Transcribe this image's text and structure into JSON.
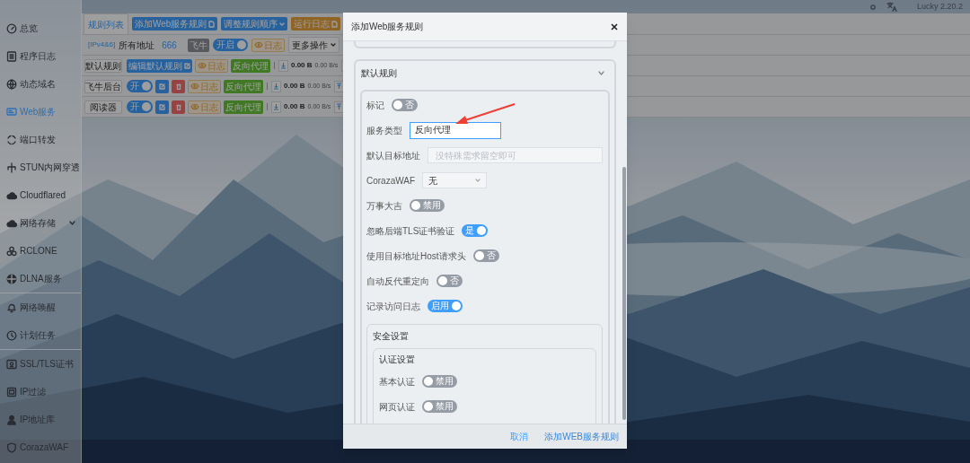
{
  "top_bar": {
    "version": "Lucky 2.20.2"
  },
  "sidebar": {
    "groups": [
      {
        "items": [
          {
            "label": "总览",
            "selected": false
          },
          {
            "label": "程序日志",
            "selected": false
          },
          {
            "label": "动态域名",
            "selected": false
          },
          {
            "label": "Web服务",
            "selected": true
          },
          {
            "label": "端口转发",
            "selected": false
          },
          {
            "label": "STUN内网穿透",
            "selected": false
          },
          {
            "label": "Cloudflared",
            "selected": false
          },
          {
            "label": "网络存储",
            "selected": false,
            "expanded": false
          },
          {
            "label": "RCLONE",
            "selected": false
          },
          {
            "label": "DLNA服务",
            "selected": false
          }
        ]
      },
      {
        "items": [
          {
            "label": "网络唤醒",
            "selected": false
          },
          {
            "label": "计划任务",
            "selected": false
          }
        ]
      },
      {
        "items": [
          {
            "label": "SSL/TLS证书",
            "selected": false
          },
          {
            "label": "IP过滤",
            "selected": false
          },
          {
            "label": "IP地址库",
            "selected": false
          },
          {
            "label": "CorazaWAF",
            "selected": false
          }
        ]
      }
    ]
  },
  "rules_panel": {
    "tabs": [
      {
        "label": "规则列表",
        "selected": true
      }
    ],
    "toolbar_buttons": [
      {
        "label": "添加Web服务规则",
        "kind": "primary"
      },
      {
        "label": "调整规则顺序",
        "kind": "primary-dropdown"
      },
      {
        "label": "运行日志",
        "kind": "warning"
      }
    ],
    "rule": {
      "protocol": "[IPv4&6]",
      "address": "所有地址",
      "port": "666",
      "name": "飞牛",
      "enabled": true,
      "enabled_text": "开启",
      "log": "日志",
      "more": "更多操作"
    },
    "sub_rules": [
      {
        "kind": "default",
        "name": "默认规则",
        "edit": "编辑默认规则",
        "log": "日志",
        "type": "反向代理",
        "traffic": "0.00 B",
        "rate": "0.00 B/s"
      },
      {
        "kind": "custom",
        "name": "飞牛后台",
        "enabled": true,
        "enabled_text": "开",
        "log": "日志",
        "type": "反向代理",
        "traffic": "0.00 B",
        "rate": "0.00 B/s"
      },
      {
        "kind": "custom",
        "name": "阅读器",
        "enabled": true,
        "enabled_text": "开",
        "log": "日志",
        "type": "反向代理",
        "traffic": "0.00 B",
        "rate": "0.00 B/s"
      }
    ]
  },
  "dialog": {
    "title": "添加Web服务规则",
    "section": {
      "title": "默认规则",
      "expanded": true,
      "fields": [
        {
          "kind": "toggle",
          "label": "标记",
          "on": false,
          "state_text": "否"
        },
        {
          "kind": "input",
          "label": "服务类型",
          "value": "反向代理",
          "focused": true
        },
        {
          "kind": "textarea",
          "label": "默认目标地址",
          "placeholder": "没特殊需求留空即可"
        },
        {
          "kind": "select",
          "label": "CorazaWAF",
          "value": "无"
        },
        {
          "kind": "toggle",
          "label": "万事大吉",
          "on": false,
          "state_text": "禁用"
        },
        {
          "kind": "toggle",
          "label": "忽略后端TLS证书验证",
          "on": true,
          "state_text": "是"
        },
        {
          "kind": "toggle",
          "label": "使用目标地址Host请求头",
          "on": false,
          "state_text": "否"
        },
        {
          "kind": "toggle",
          "label": "自动反代重定向",
          "on": false,
          "state_text": "否"
        },
        {
          "kind": "toggle",
          "label": "记录访问日志",
          "on": true,
          "state_text": "启用"
        }
      ],
      "security": {
        "title": "安全设置",
        "auth": {
          "title": "认证设置",
          "fields": [
            {
              "kind": "toggle",
              "label": "基本认证",
              "on": false,
              "state_text": "禁用"
            },
            {
              "kind": "toggle",
              "label": "网页认证",
              "on": false,
              "state_text": "禁用"
            }
          ]
        }
      }
    },
    "buttons": [
      {
        "label": "取消",
        "kind": "cancel"
      },
      {
        "label": "添加WEB服务规则",
        "kind": "confirm"
      }
    ]
  }
}
